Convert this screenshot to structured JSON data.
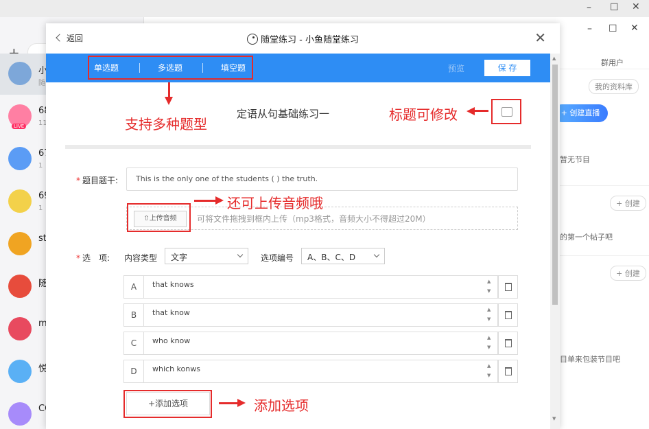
{
  "background": {
    "chats": [
      {
        "name": "小",
        "sub": "随"
      },
      {
        "name": "68",
        "sub": "11",
        "live": "LIVE"
      },
      {
        "name": "67",
        "sub": "1"
      },
      {
        "name": "69",
        "sub": "1"
      },
      {
        "name": "st",
        "sub": ""
      },
      {
        "name": "随",
        "sub": ""
      },
      {
        "name": "m",
        "sub": ""
      },
      {
        "name": "悦",
        "sub": ""
      },
      {
        "name": "CO",
        "sub": ""
      }
    ],
    "right": {
      "group_users": "群用户",
      "my_library": "我的资料库",
      "create_live": "+ 创建直播",
      "no_program": "暂无节目",
      "create_1": "+ 创建",
      "first_post": "的第一个帖子吧",
      "create_2": "+ 创建",
      "pack_program": "目单来包装节目吧"
    }
  },
  "modal": {
    "back": "返回",
    "title": "随堂练习 - 小鱼随堂练习",
    "tabs": [
      "单选题",
      "多选题",
      "填空题"
    ],
    "preview": "预览",
    "save": "保 存",
    "quiz_title": "定语从句基础练习一",
    "stem_label": "题目题干:",
    "stem_value": "This is the only one of the students ( ) the truth.",
    "upload_button": "上传音频",
    "upload_hint": "可将文件拖拽到框内上传（mp3格式，音频大小不得超过20M）",
    "options_label": "选　项:",
    "content_type_label": "内容类型",
    "content_type_value": "文字",
    "numbering_label": "选项编号",
    "numbering_value": "A、B、C、D",
    "options": [
      {
        "letter": "A",
        "text": "that knows"
      },
      {
        "letter": "B",
        "text": "that know"
      },
      {
        "letter": "C",
        "text": "who know"
      },
      {
        "letter": "D",
        "text": "which konws"
      }
    ],
    "add_option": "+添加选项"
  },
  "annotations": {
    "types": "支持多种题型",
    "title_editable": "标题可修改",
    "upload_audio": "还可上传音频哦",
    "add_option": "添加选项"
  },
  "colors": {
    "accent": "#2e8df4",
    "annotation": "#e52b2b"
  }
}
